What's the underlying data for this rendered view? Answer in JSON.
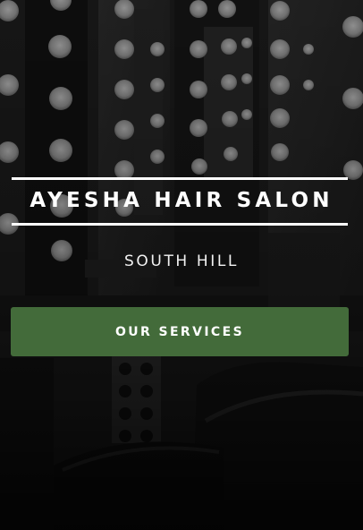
{
  "hero": {
    "title": "AYESHA HAIR SALON",
    "subtitle": "SOUTH HILL",
    "cta_label": "OUR SERVICES",
    "background_image": "salon-mirrors-with-vanity-lights"
  },
  "colors": {
    "cta_background": "#436b3a",
    "text": "#ffffff",
    "rules": "#ffffff"
  }
}
